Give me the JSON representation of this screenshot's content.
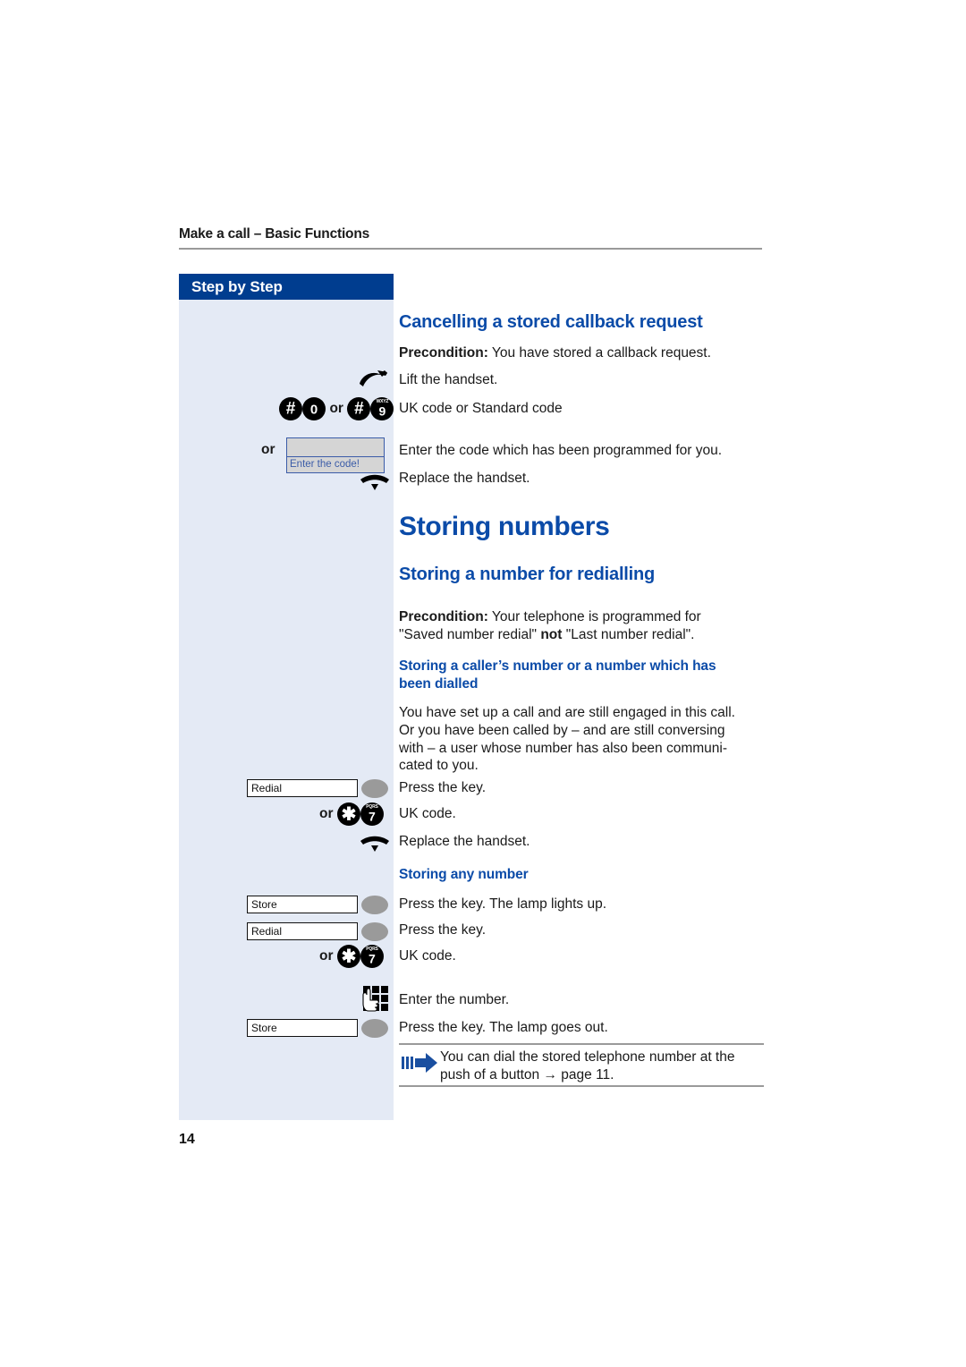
{
  "document": {
    "running_head": "Make a call – Basic Functions",
    "page_number": "14",
    "sidebar_header": "Step by Step",
    "accent_blue": "#0b4ba8",
    "header_navy": "#003d8f",
    "panel_blue": "#e4eaf5"
  },
  "sections": {
    "cancel_callback": {
      "heading": "Cancelling a stored callback request",
      "precondition_label": "Precondition:",
      "precondition_text": " You have stored a callback request.",
      "steps": [
        {
          "icon": "lift-handset-icon",
          "text": "Lift the handset."
        },
        {
          "icon": "keypad-code-hash-0-or-hash-9",
          "text": "UK code or Standard code"
        },
        {
          "icon": "display-box-enter-code",
          "text": "Enter the code which has been programmed for you."
        },
        {
          "icon": "replace-handset-icon",
          "text": "Replace the handset."
        }
      ],
      "keys": {
        "hash": "#",
        "zero": "0",
        "or": "or",
        "nine": "9",
        "nine_letters": "WXYZ"
      },
      "display": {
        "or_label": "or",
        "line1": "",
        "line2": "Enter the code!"
      }
    },
    "storing_numbers": {
      "heading": "Storing numbers"
    },
    "storing_redial": {
      "heading": "Storing a number for redialling",
      "precondition_label": "Precondition:",
      "precondition_line1_rest": " Your telephone is programmed for",
      "precondition_line2_a": "\"Saved number redial\" ",
      "precondition_line2_bold": "not",
      "precondition_line2_b": " \"Last number redial\"."
    },
    "storing_caller": {
      "heading_line1": "Storing a caller’s number or a number which has",
      "heading_line2": "been dialled",
      "body_line1": "You have set up a call and are still engaged in this call.",
      "body_line2": "Or you have been called by – and are still conversing",
      "body_line3": "with – a user whose number has also been communi-",
      "body_line4": "cated to you.",
      "steps": [
        {
          "icon": "redial-function-key",
          "key_label": "Redial",
          "lamp": "on",
          "text": "Press the key."
        },
        {
          "icon": "keypad-code-star-7",
          "text": "UK code."
        },
        {
          "icon": "replace-handset-icon",
          "text": "Replace the handset."
        }
      ],
      "keys": {
        "or": "or",
        "star": "✱",
        "seven": "7",
        "seven_letters": "PQRS"
      }
    },
    "storing_any": {
      "heading": "Storing any number",
      "steps": [
        {
          "icon": "store-function-key",
          "key_label": "Store",
          "lamp": "on",
          "text": "Press the key. The lamp lights up."
        },
        {
          "icon": "redial-function-key",
          "key_label": "Redial",
          "lamp": "on",
          "text": "Press the key."
        },
        {
          "icon": "keypad-code-star-7",
          "text": "UK code."
        },
        {
          "icon": "keypad-icon",
          "text": "Enter the number."
        },
        {
          "icon": "store-function-key",
          "key_label": "Store",
          "lamp": "off",
          "text": "Press the key. The lamp goes out."
        }
      ],
      "keys": {
        "or": "or",
        "star": "✱",
        "seven": "7",
        "seven_letters": "PQRS"
      }
    },
    "tip": {
      "icon": "blue-arrow-tip-icon",
      "line1": "You can dial the stored telephone number at the",
      "line2_a": "push of a button ",
      "line2_arrow": "→",
      "line2_b": " page 11."
    }
  }
}
